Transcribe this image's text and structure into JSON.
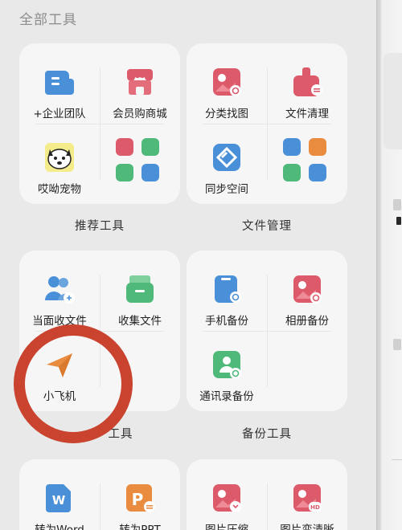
{
  "page_title": "全部工具",
  "groups": {
    "recommended": {
      "label": "推荐工具",
      "items": [
        {
          "label": "+企业团队",
          "icon": "enterprise-team-icon"
        },
        {
          "label": "会员购商城",
          "icon": "shop-icon"
        },
        {
          "label": "哎呦宠物",
          "icon": "pet-icon"
        },
        {
          "label": "",
          "icon": "more-tools-grid-icon"
        }
      ]
    },
    "file_management": {
      "label": "文件管理",
      "items": [
        {
          "label": "分类找图",
          "icon": "image-search-icon"
        },
        {
          "label": "文件清理",
          "icon": "file-clean-icon"
        },
        {
          "label": "同步空间",
          "icon": "sync-space-icon"
        },
        {
          "label": "",
          "icon": "more-tools-grid-icon"
        }
      ]
    },
    "transfer": {
      "label": "工具",
      "items": [
        {
          "label": "当面收文件",
          "icon": "receive-files-icon"
        },
        {
          "label": "收集文件",
          "icon": "collect-files-icon"
        },
        {
          "label": "小飞机",
          "icon": "paper-plane-icon"
        }
      ]
    },
    "backup": {
      "label": "备份工具",
      "items": [
        {
          "label": "手机备份",
          "icon": "phone-backup-icon"
        },
        {
          "label": "相册备份",
          "icon": "album-backup-icon"
        },
        {
          "label": "通讯录备份",
          "icon": "contacts-backup-icon"
        }
      ]
    },
    "convert": {
      "items": [
        {
          "label": "转为Word",
          "icon": "word-icon",
          "glyph": "W"
        },
        {
          "label": "转为PPT",
          "icon": "ppt-icon",
          "glyph": "P"
        }
      ]
    },
    "image": {
      "items": [
        {
          "label": "图片压缩",
          "icon": "image-compress-icon"
        },
        {
          "label": "图片变清晰",
          "icon": "image-enhance-icon",
          "glyph": "HD"
        }
      ]
    }
  },
  "colors": {
    "blue": "#4a90d9",
    "red": "#dc5a6a",
    "green": "#4fb97a",
    "orange": "#e98c3f",
    "highlight_ring": "#c9432f"
  }
}
